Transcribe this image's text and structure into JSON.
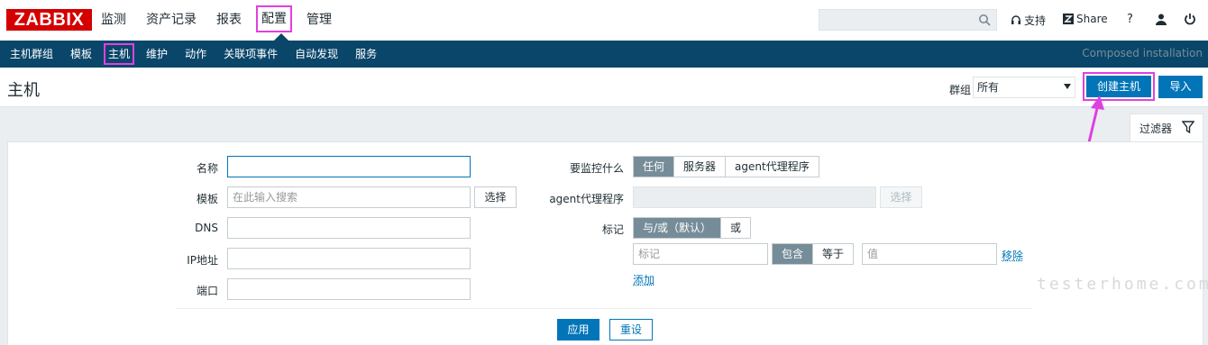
{
  "logo": "ZABBIX",
  "main_menu": [
    "监测",
    "资产记录",
    "报表",
    "配置",
    "管理"
  ],
  "main_menu_selected": "配置",
  "top_right": {
    "support": "支持",
    "share": "Share",
    "help": "?"
  },
  "sub_menu": [
    "主机群组",
    "模板",
    "主机",
    "维护",
    "动作",
    "关联项事件",
    "自动发现",
    "服务"
  ],
  "sub_menu_selected": "主机",
  "composed": "Composed installation",
  "page_title": "主机",
  "group_label": "群组",
  "group_value": "所有",
  "create_host": "创建主机",
  "import": "导入",
  "filter_tab": "过滤器",
  "filter": {
    "name_label": "名称",
    "template_label": "模板",
    "template_placeholder": "在此输入搜索",
    "select": "选择",
    "dns_label": "DNS",
    "ip_label": "IP地址",
    "port_label": "端口",
    "monitored_by_label": "要监控什么",
    "monitored_by_options": [
      "任何",
      "服务器",
      "agent代理程序"
    ],
    "proxy_label": "agent代理程序",
    "proxy_select": "选择",
    "tags_label": "标记",
    "tags_mode_options": [
      "与/或（默认）",
      "或"
    ],
    "tag_placeholder": "标记",
    "operator_options": [
      "包含",
      "等于"
    ],
    "value_placeholder": "值",
    "remove": "移除",
    "add": "添加",
    "apply": "应用",
    "reset": "重设"
  },
  "watermark": "testerhome.com",
  "colors": {
    "brand": "#d40000",
    "nav": "#0a466a",
    "accent": "#0275b8",
    "highlight": "#e040e0"
  }
}
